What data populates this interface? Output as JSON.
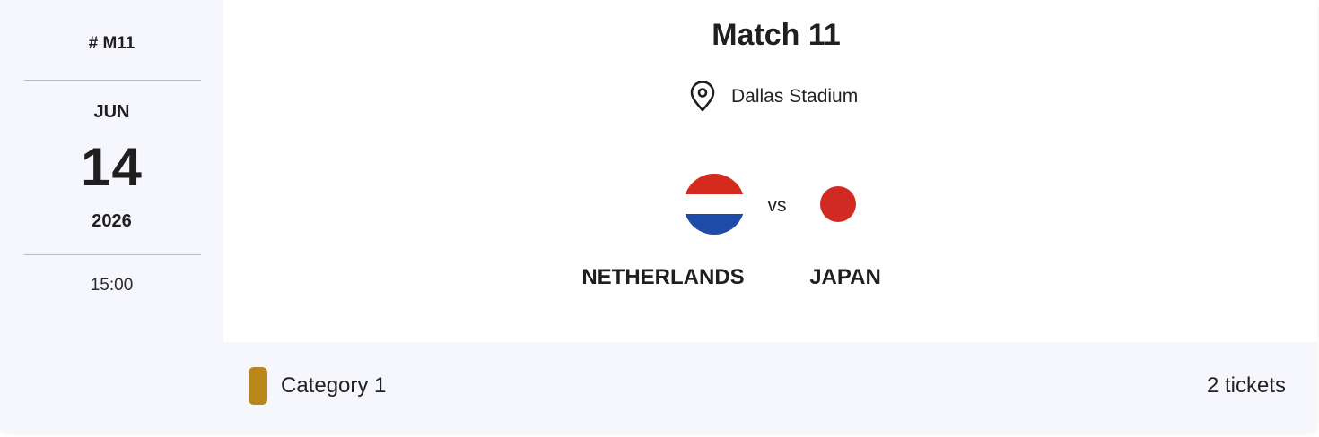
{
  "match": {
    "code": "# M11",
    "date": {
      "month": "JUN",
      "day": "14",
      "year": "2026"
    },
    "time": "15:00",
    "title": "Match 11",
    "venue": "Dallas Stadium",
    "vs_label": "vs",
    "home_team": {
      "name": "NETHERLANDS",
      "flag_icon": "netherlands-flag-icon",
      "colors": [
        "#d52b1e",
        "#ffffff",
        "#1e4aa8"
      ]
    },
    "away_team": {
      "name": "JAPAN",
      "flag_icon": "japan-flag-icon",
      "colors": [
        "#ffffff",
        "#d12a23"
      ]
    }
  },
  "ticket": {
    "category_label": "Category 1",
    "category_color": "#b8861b",
    "count_label": "2 tickets"
  },
  "icons": {
    "venue": "location-pin-icon"
  }
}
